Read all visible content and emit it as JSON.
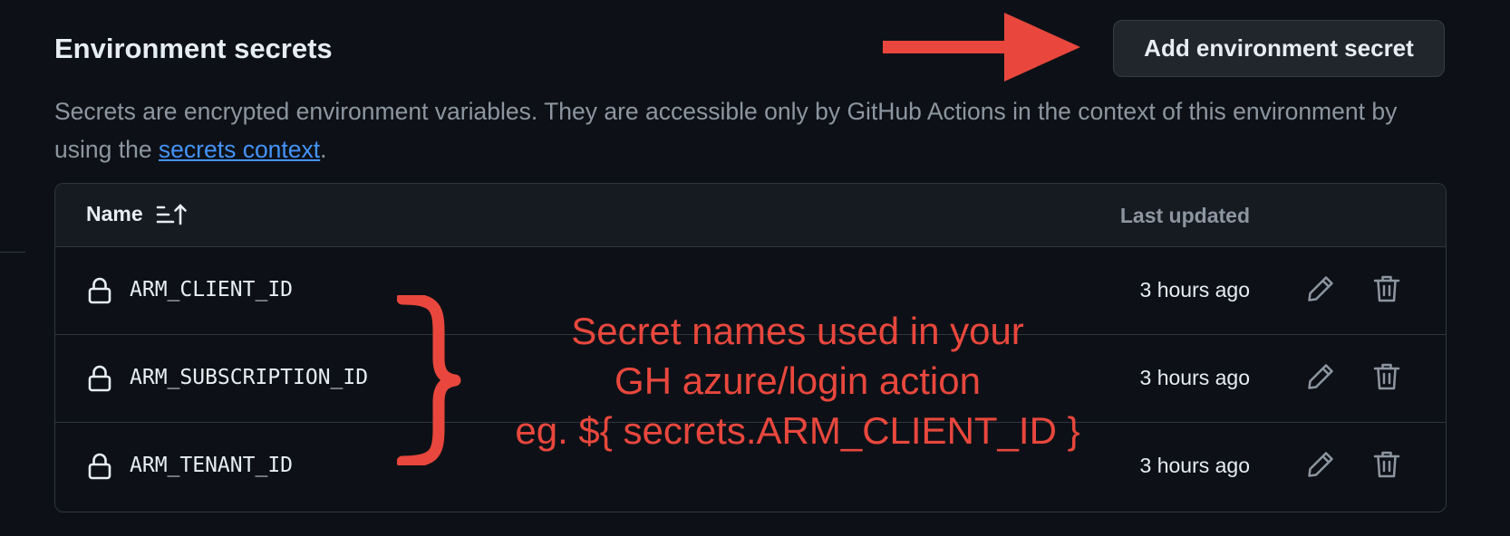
{
  "header": {
    "title": "Environment secrets",
    "add_button_label": "Add environment secret"
  },
  "description": {
    "text_before_link": "Secrets are encrypted environment variables. They are accessible only by GitHub Actions in the context of this environment by using the ",
    "link_text": "secrets context",
    "text_after_link": "."
  },
  "table": {
    "columns": {
      "name": "Name",
      "last_updated": "Last updated"
    },
    "rows": [
      {
        "name": "ARM_CLIENT_ID",
        "updated": "3 hours ago"
      },
      {
        "name": "ARM_SUBSCRIPTION_ID",
        "updated": "3 hours ago"
      },
      {
        "name": "ARM_TENANT_ID",
        "updated": "3 hours ago"
      }
    ]
  },
  "annotation": {
    "lines": [
      "Secret names used in your",
      "GH azure/login action",
      "eg. ${ secrets.ARM_CLIENT_ID }"
    ],
    "color": "#e9473d"
  },
  "icons": {
    "sort": "sort-ascending-icon",
    "lock": "lock-icon",
    "edit": "pencil-icon",
    "delete": "trash-icon",
    "arrow": "arrow-right-annotation",
    "brace": "curly-brace-annotation"
  }
}
